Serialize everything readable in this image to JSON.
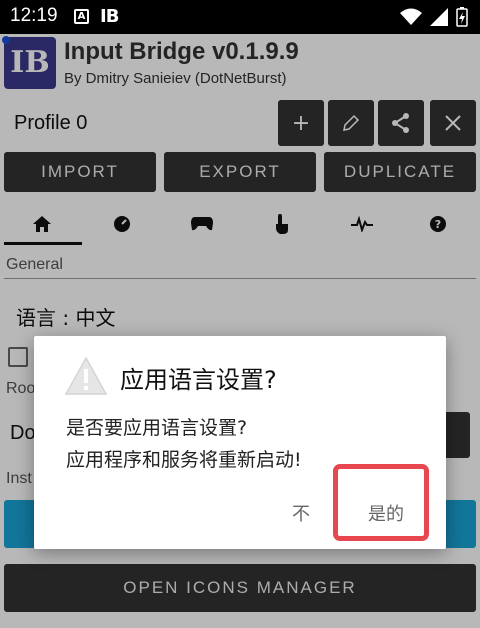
{
  "status_bar": {
    "time": "12:19",
    "notification_a": "A",
    "notification_ib": "IB"
  },
  "app": {
    "title": "Input Bridge v0.1.9.9",
    "subtitle": "By Dmitry Sanieiev (DotNetBurst)",
    "logo_text": "IB",
    "profile": "Profile 0",
    "profile_actions": [
      "+",
      "edit-icon",
      "share-icon",
      "close-icon"
    ],
    "buttons": {
      "import": "IMPORT",
      "export": "EXPORT",
      "duplicate": "DUPLICATE"
    },
    "tabs": [
      "home-icon",
      "gauge-icon",
      "gamepad-icon",
      "touch-icon",
      "pulse-icon",
      "help-icon"
    ],
    "section_general": "General",
    "language_label": "语言 : 中文",
    "root_label": "Roo",
    "do_text": "Do",
    "inst_label": "Inst",
    "open_icons_manager": "OPEN ICONS MANAGER"
  },
  "dialog": {
    "title": "应用语言设置?",
    "message": "是否要应用语言设置?\n应用程序和服务将重新启动!",
    "no": "不",
    "yes": "是的",
    "highlight_color": "#e8474f"
  }
}
